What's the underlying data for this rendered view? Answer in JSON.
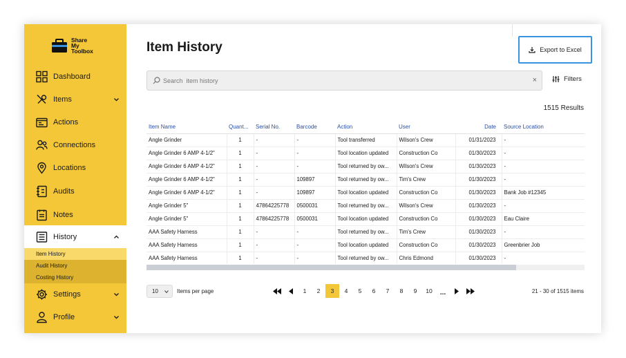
{
  "brand": {
    "line1": "Share",
    "line2": "My",
    "line3": "Toolbox"
  },
  "sidebar": {
    "items": [
      {
        "label": "Dashboard",
        "icon": "dashboard-icon",
        "has_chevron": false
      },
      {
        "label": "Items",
        "icon": "wrench-icon",
        "has_chevron": true
      },
      {
        "label": "Actions",
        "icon": "actions-icon",
        "has_chevron": false
      },
      {
        "label": "Connections",
        "icon": "users-icon",
        "has_chevron": false
      },
      {
        "label": "Locations",
        "icon": "location-pin-icon",
        "has_chevron": false
      },
      {
        "label": "Audits",
        "icon": "audits-icon",
        "has_chevron": false
      },
      {
        "label": "Notes",
        "icon": "notes-icon",
        "has_chevron": false
      },
      {
        "label": "History",
        "icon": "history-icon",
        "has_chevron": true,
        "expanded": true
      },
      {
        "label": "Settings",
        "icon": "gear-icon",
        "has_chevron": true
      },
      {
        "label": "Profile",
        "icon": "profile-icon",
        "has_chevron": true
      }
    ],
    "history_submenu": [
      {
        "label": "Item History",
        "selected": true
      },
      {
        "label": "Audit History",
        "selected": false
      },
      {
        "label": "Costing History",
        "selected": false
      }
    ]
  },
  "header": {
    "title": "Item History",
    "export_label": "Export to Excel"
  },
  "search": {
    "placeholder": "Search  item history",
    "value": ""
  },
  "filters_label": "Filters",
  "results_label": "1515 Results",
  "table": {
    "columns": [
      "Item Name",
      "Quant...",
      "Serial No.",
      "Barcode",
      "Action",
      "User",
      "Date",
      "Source Location"
    ],
    "rows": [
      [
        "Angle Grinder",
        "1",
        "-",
        "-",
        "Tool transferred",
        "Wilson's Crew",
        "01/31/2023",
        "-"
      ],
      [
        "Angle Grinder 6 AMP 4-1/2\"",
        "1",
        "-",
        "-",
        "Tool location updated",
        "Construction Co",
        "01/30/2023",
        "-"
      ],
      [
        "Angle Grinder 6 AMP 4-1/2\"",
        "1",
        "-",
        "-",
        "Tool returned by ow...",
        "Wilson's Crew",
        "01/30/2023",
        "-"
      ],
      [
        "Angle Grinder 6 AMP 4-1/2\"",
        "1",
        "-",
        "109897",
        "Tool returned by ow...",
        "Tim's Crew",
        "01/30/2023",
        "-"
      ],
      [
        "Angle Grinder 6 AMP 4-1/2\"",
        "1",
        "-",
        "109897",
        "Tool location updated",
        "Construction Co",
        "01/30/2023",
        "Bank Job #12345"
      ],
      [
        "Angle Grinder 5\"",
        "1",
        "47864225778",
        "0500031",
        "Tool returned by ow...",
        "Wilson's Crew",
        "01/30/2023",
        "-"
      ],
      [
        "Angle Grinder 5\"",
        "1",
        "47864225778",
        "0500031",
        "Tool location updated",
        "Construction Co",
        "01/30/2023",
        "Eau Claire"
      ],
      [
        "AAA Safety Harness",
        "1",
        "-",
        "-",
        "Tool returned by ow...",
        "Tim's Crew",
        "01/30/2023",
        "-"
      ],
      [
        "AAA Safety Harness",
        "1",
        "-",
        "-",
        "Tool location updated",
        "Construction Co",
        "01/30/2023",
        "Greenbrier Job"
      ],
      [
        "AAA Safety Harness",
        "1",
        "-",
        "-",
        "Tool returned by ow...",
        "Chris Edmond",
        "01/30/2023",
        "-"
      ]
    ]
  },
  "pagination": {
    "per_page": "10",
    "per_page_label": "Items per page",
    "pages": [
      "1",
      "2",
      "3",
      "4",
      "5",
      "6",
      "7",
      "8",
      "9",
      "10"
    ],
    "current_page": "3",
    "ellipsis": "...",
    "range_label": "21 - 30 of 1515 items"
  },
  "colors": {
    "sidebar": "#f3c738",
    "submenu": "#dcb22f",
    "selected_sub": "#f8d96a",
    "export_border": "#3a93e0",
    "header_text": "#2a4ea3"
  }
}
